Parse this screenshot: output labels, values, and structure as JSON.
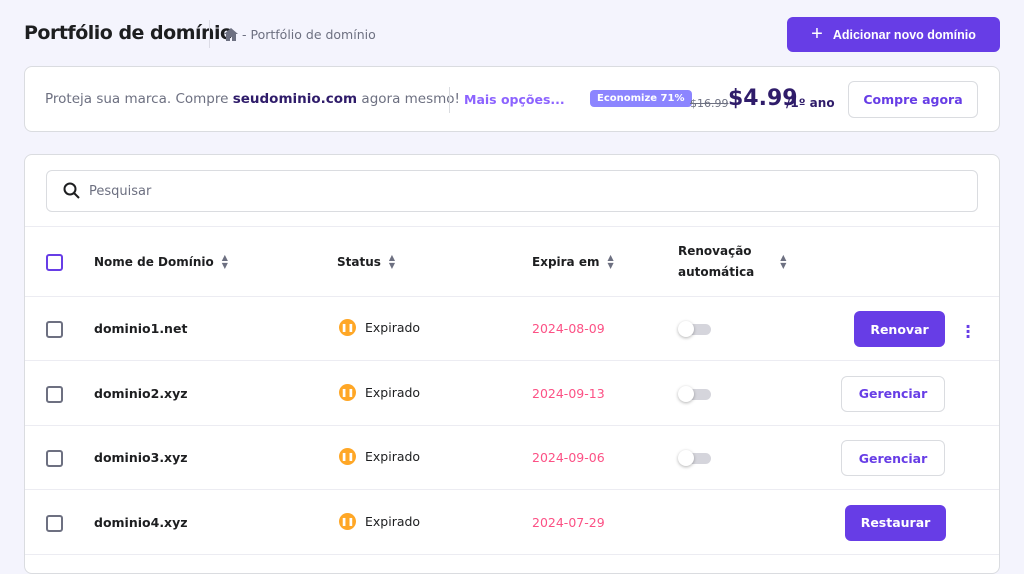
{
  "header": {
    "title": "Portfólio de domínio",
    "breadcrumb": "- Portfólio de domínio",
    "add_button": "Adicionar novo domínio"
  },
  "promo": {
    "text_before": "Proteja sua marca. Compre ",
    "domain": "seudominio.com",
    "text_after": " agora mesmo!",
    "more": "Mais opções...",
    "badge": "Economize 71%",
    "old_price": "$16.99",
    "price": "$4.99",
    "period": "/1º ano",
    "buy": "Compre agora"
  },
  "search": {
    "placeholder": "Pesquisar"
  },
  "table": {
    "headers": {
      "name": "Nome de Domínio",
      "status": "Status",
      "expires": "Expira em",
      "auto_renew_1": "Renovação",
      "auto_renew_2": "automática"
    },
    "rows": [
      {
        "domain": "dominio1.net",
        "status": "Expirado",
        "expires": "2024-08-09",
        "action": "Renovar"
      },
      {
        "domain": "dominio2.xyz",
        "status": "Expirado",
        "expires": "2024-09-13",
        "action": "Gerenciar"
      },
      {
        "domain": "dominio3.xyz",
        "status": "Expirado",
        "expires": "2024-09-06",
        "action": "Gerenciar"
      },
      {
        "domain": "dominio4.xyz",
        "status": "Expirado",
        "expires": "2024-07-29",
        "action": "Restaurar"
      }
    ]
  },
  "colors": {
    "primary": "#673de6",
    "expired_date": "#fc5185",
    "warning": "#ffa726"
  }
}
